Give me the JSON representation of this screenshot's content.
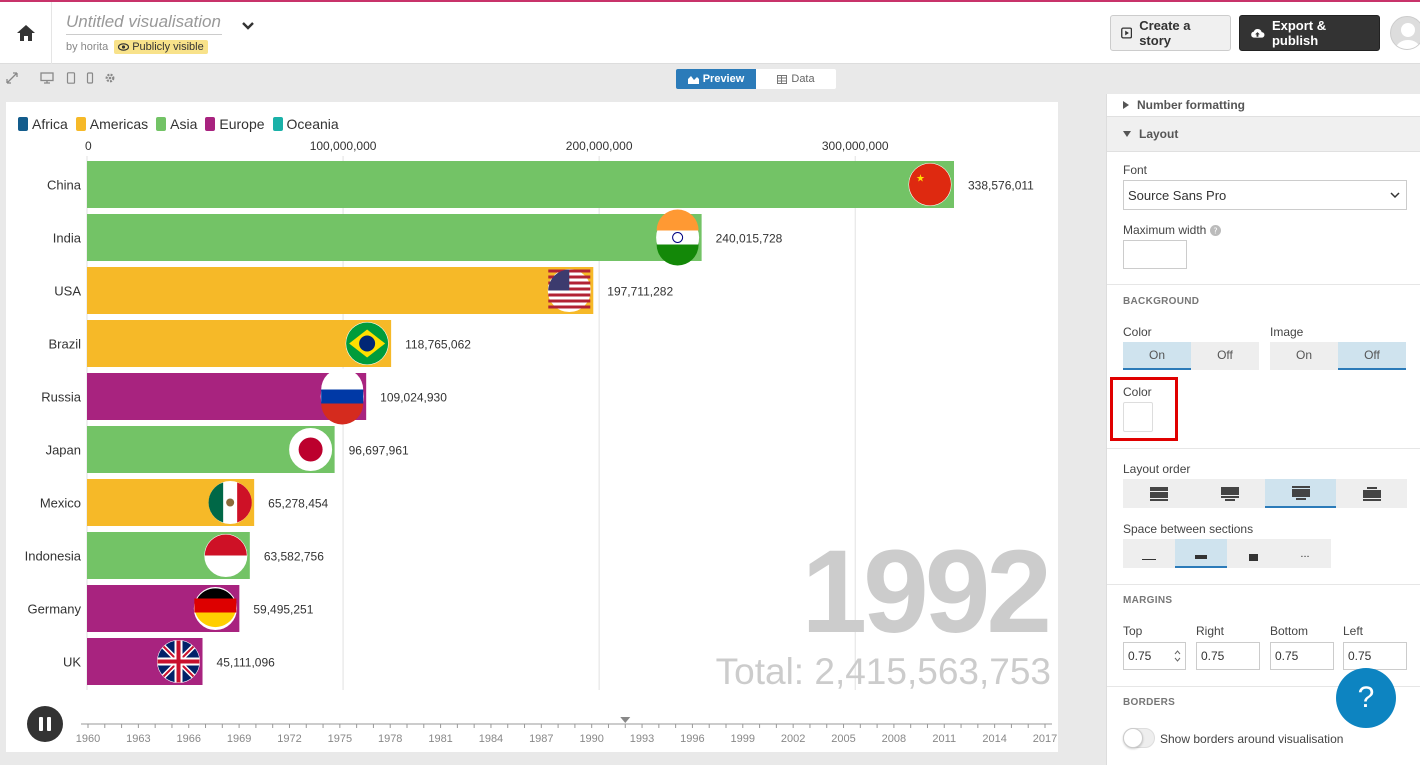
{
  "header": {
    "title": "Untitled visualisation",
    "byline": "by horita",
    "visibility": "Publicly visible",
    "create_story": "Create a story",
    "export_publish": "Export & publish"
  },
  "toolbar": {
    "preview_tab": "Preview",
    "data_tab": "Data"
  },
  "legend": [
    {
      "name": "Africa",
      "color": "#135c8c"
    },
    {
      "name": "Americas",
      "color": "#f6b928"
    },
    {
      "name": "Asia",
      "color": "#73c366"
    },
    {
      "name": "Europe",
      "color": "#a8237f"
    },
    {
      "name": "Oceania",
      "color": "#1ab1a8"
    }
  ],
  "chart_data": {
    "type": "bar",
    "orientation": "horizontal",
    "year": "1992",
    "total_label": "Total: 2,415,563,753",
    "x_ticks": [
      "0",
      "100,000,000",
      "200,000,000",
      "300,000,000"
    ],
    "x_tick_values": [
      0,
      100000000,
      200000000,
      300000000
    ],
    "xlim": [
      0,
      338576011
    ],
    "categories": [
      "China",
      "India",
      "USA",
      "Brazil",
      "Russia",
      "Japan",
      "Mexico",
      "Indonesia",
      "Germany",
      "UK"
    ],
    "values": [
      338576011,
      240015728,
      197711282,
      118765062,
      109024930,
      96697961,
      65278454,
      63582756,
      59495251,
      45111096
    ],
    "value_labels": [
      "338,576,011",
      "240,015,728",
      "197,711,282",
      "118,765,062",
      "109,024,930",
      "96,697,961",
      "65,278,454",
      "63,582,756",
      "59,495,251",
      "45,111,096"
    ],
    "regions": [
      "Asia",
      "Asia",
      "Americas",
      "Americas",
      "Europe",
      "Asia",
      "Americas",
      "Asia",
      "Europe",
      "Europe"
    ],
    "timeline_ticks": [
      "1960",
      "1963",
      "1966",
      "1969",
      "1972",
      "1975",
      "1978",
      "1981",
      "1984",
      "1987",
      "1990",
      "1993",
      "1996",
      "1999",
      "2002",
      "2005",
      "2008",
      "2011",
      "2014",
      "2017"
    ]
  },
  "panel": {
    "number_formatting": "Number formatting",
    "layout": "Layout",
    "font_label": "Font",
    "font_value": "Source Sans Pro",
    "max_width_label": "Maximum width",
    "background_heading": "BACKGROUND",
    "color_label": "Color",
    "image_label": "Image",
    "on": "On",
    "off": "Off",
    "color_picker_label": "Color",
    "layout_order_label": "Layout order",
    "space_label": "Space between sections",
    "space_more": "...",
    "margins_heading": "MARGINS",
    "top_label": "Top",
    "right_label": "Right",
    "bottom_label": "Bottom",
    "left_label": "Left",
    "top_value": "0.75",
    "right_value": "0.75",
    "bottom_value": "0.75",
    "left_value": "0.75",
    "borders_heading": "BORDERS",
    "borders_toggle": "Show borders around visualisation"
  },
  "help": "?"
}
